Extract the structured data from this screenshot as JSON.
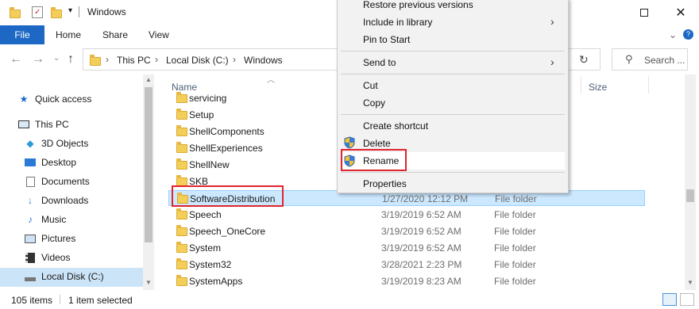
{
  "window": {
    "title": "Windows",
    "minimize_icon": "minimize-icon",
    "maximize_icon": "maximize-icon",
    "close_icon": "close-icon"
  },
  "ribbon": {
    "file": "File",
    "tabs": [
      "Home",
      "Share",
      "View"
    ],
    "help_icon": "help-icon"
  },
  "address": {
    "crumbs": [
      "This PC",
      "Local Disk (C:)",
      "Windows"
    ],
    "search_placeholder": "Search ..."
  },
  "sidebar": {
    "items": [
      {
        "label": "Quick access",
        "icon": "star-icon"
      },
      {
        "label": "This PC",
        "icon": "computer-icon"
      },
      {
        "label": "3D Objects",
        "icon": "cube-icon"
      },
      {
        "label": "Desktop",
        "icon": "desktop-icon"
      },
      {
        "label": "Documents",
        "icon": "document-icon"
      },
      {
        "label": "Downloads",
        "icon": "download-icon"
      },
      {
        "label": "Music",
        "icon": "music-icon"
      },
      {
        "label": "Pictures",
        "icon": "picture-icon"
      },
      {
        "label": "Videos",
        "icon": "video-icon"
      },
      {
        "label": "Local Disk (C:)",
        "icon": "drive-icon"
      }
    ]
  },
  "filelist": {
    "columns": {
      "name": "Name",
      "size": "Size"
    },
    "rows": [
      {
        "name": "servicing",
        "date": "",
        "type": ""
      },
      {
        "name": "Setup",
        "date": "",
        "type": ""
      },
      {
        "name": "ShellComponents",
        "date": "",
        "type": ""
      },
      {
        "name": "ShellExperiences",
        "date": "",
        "type": ""
      },
      {
        "name": "ShellNew",
        "date": "",
        "type": ""
      },
      {
        "name": "SKB",
        "date": "",
        "type": ""
      },
      {
        "name": "SoftwareDistribution",
        "date": "1/27/2020 12:12 PM",
        "type": "File folder"
      },
      {
        "name": "Speech",
        "date": "3/19/2019 6:52 AM",
        "type": "File folder"
      },
      {
        "name": "Speech_OneCore",
        "date": "3/19/2019 6:52 AM",
        "type": "File folder"
      },
      {
        "name": "System",
        "date": "3/19/2019 6:52 AM",
        "type": "File folder"
      },
      {
        "name": "System32",
        "date": "3/28/2021 2:23 PM",
        "type": "File folder"
      },
      {
        "name": "SystemApps",
        "date": "3/19/2019 8:23 AM",
        "type": "File folder"
      }
    ]
  },
  "context_menu": {
    "items": [
      "Restore previous versions",
      "Include in library",
      "Pin to Start",
      "Send to",
      "Cut",
      "Copy",
      "Create shortcut",
      "Delete",
      "Rename",
      "Properties"
    ]
  },
  "status": {
    "items_count": "105 items",
    "selected": "1 item selected"
  },
  "colors": {
    "accent": "#1c68c4",
    "selection": "#cce8ff",
    "highlight": "#e0242e"
  }
}
